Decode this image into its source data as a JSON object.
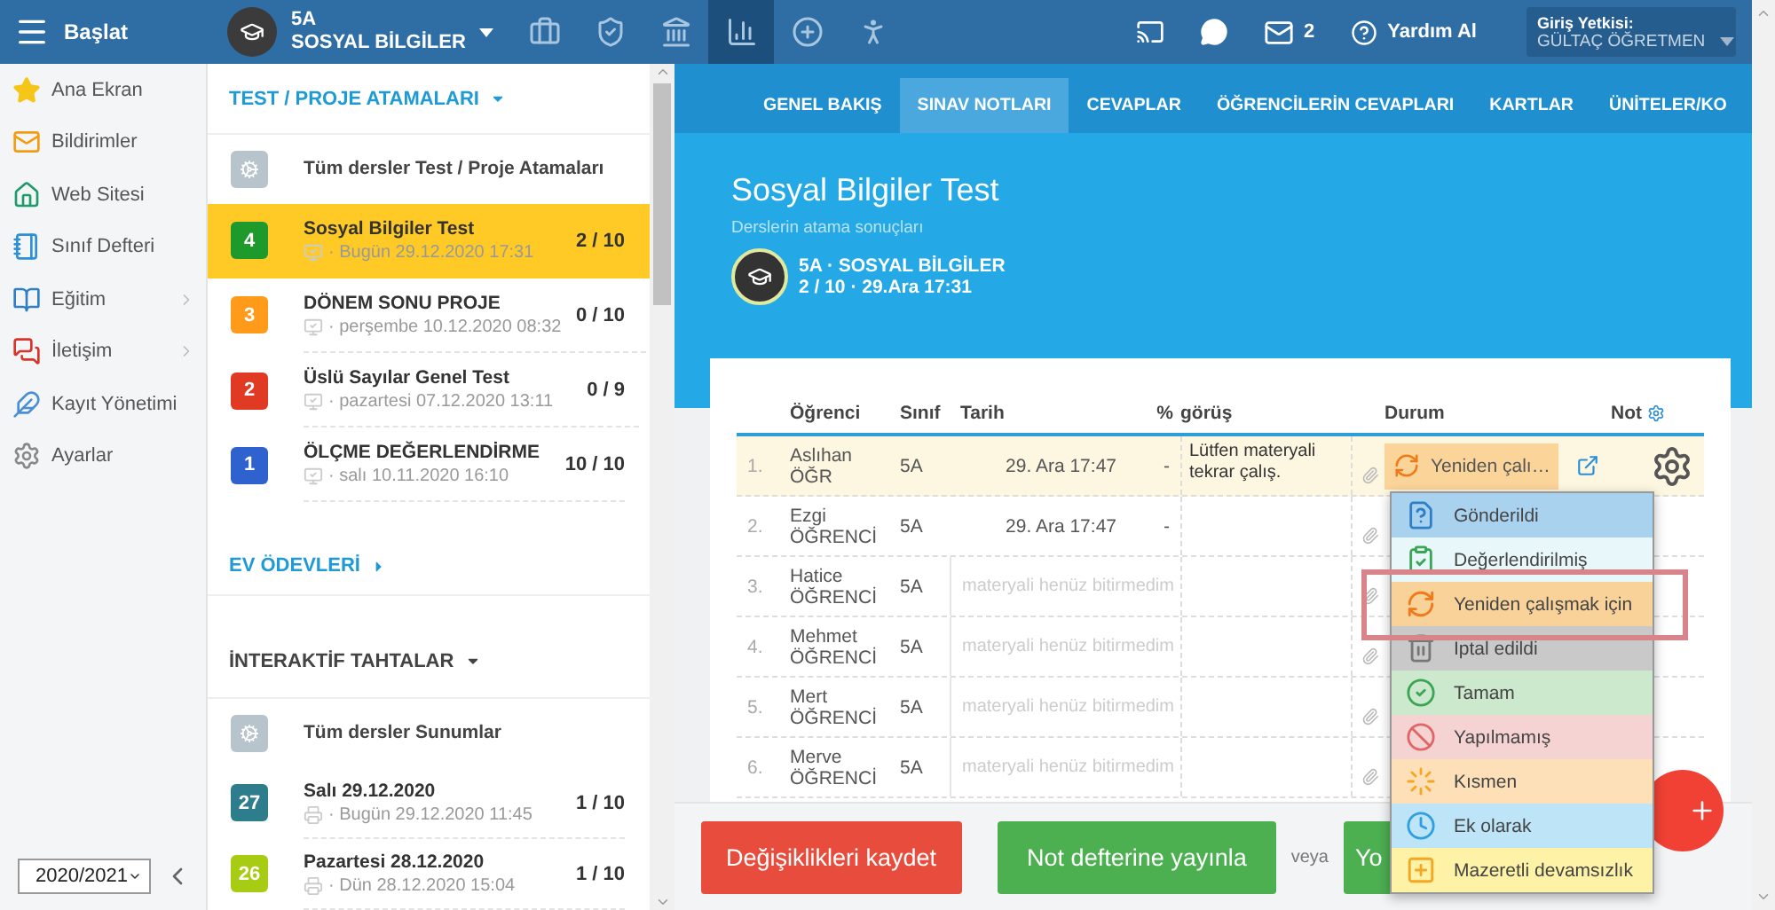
{
  "topbar": {
    "menu_label": "Başlat",
    "class_name": "5A",
    "class_subject": "SOSYAL BİLGİLER",
    "tools": [
      {
        "selected": false
      },
      {
        "selected": false
      },
      {
        "selected": false
      },
      {
        "selected": true
      },
      {
        "selected": false
      },
      {
        "selected": false
      }
    ],
    "mail_count": "2",
    "help": "Yardım Al",
    "login_label": "Giriş Yetkisi:",
    "login_user": "GÜLTAÇ ÖĞRETMEN"
  },
  "sidebar": {
    "items": [
      {
        "label": "Ana Ekran",
        "has_submenu": false
      },
      {
        "label": "Bildirimler",
        "has_submenu": false
      },
      {
        "label": "Web Sitesi",
        "has_submenu": false
      },
      {
        "label": "Sınıf Defteri",
        "has_submenu": false
      },
      {
        "label": "Eğitim",
        "has_submenu": true
      },
      {
        "label": "İletişim",
        "has_submenu": true
      },
      {
        "label": "Kayıt Yönetimi",
        "has_submenu": false
      },
      {
        "label": "Ayarlar",
        "has_submenu": false
      }
    ],
    "year": "2020/2021"
  },
  "sections": [
    {
      "title": "TEST / PROJE ATAMALARI",
      "kind": "tests",
      "expanded": true,
      "all_label": "Tüm dersler Test / Proje Atamaları",
      "items": [
        {
          "badge": "4",
          "color": "#1e9a2c",
          "title": "Sosyal Bilgiler Test",
          "date": "· Bugün 29.12.2020 17:31",
          "score": "2 / 10",
          "selected": true
        },
        {
          "badge": "3",
          "color": "#ff9a1a",
          "title": "DÖNEM SONU PROJE",
          "date": "· perşembe 10.12.2020 08:32",
          "score": "0 / 10",
          "selected": false
        },
        {
          "badge": "2",
          "color": "#e03a24",
          "title": "Üslü Sayılar Genel Test",
          "date": "· pazartesi 07.12.2020 13:11",
          "score": "0 / 9",
          "selected": false
        },
        {
          "badge": "1",
          "color": "#2f62cf",
          "title": "ÖLÇME DEĞERLENDİRME",
          "date": "· salı 10.11.2020 16:10",
          "score": "10 / 10",
          "selected": false
        }
      ]
    },
    {
      "title": "EV ÖDEVLERİ",
      "kind": "homework",
      "expanded": false
    },
    {
      "title": "İNTERAKTİF TAHTALAR",
      "kind": "boards",
      "expanded": true,
      "all_label": "Tüm dersler Sunumlar",
      "items": [
        {
          "badge": "27",
          "color": "#2e7d8c",
          "title": "Salı 29.12.2020",
          "date": "· Bugün 29.12.2020 11:45",
          "score": "1 / 10",
          "selected": false
        },
        {
          "badge": "26",
          "color": "#a8cc14",
          "title": "Pazartesi 28.12.2020",
          "date": "· Dün 28.12.2020 15:04",
          "score": "1 / 10",
          "selected": false
        }
      ]
    }
  ],
  "tabs": [
    {
      "label": "GENEL BAKIŞ",
      "selected": false
    },
    {
      "label": "SINAV NOTLARI",
      "selected": true
    },
    {
      "label": "CEVAPLAR",
      "selected": false
    },
    {
      "label": "ÖĞRENCİLERİN CEVAPLARI",
      "selected": false
    },
    {
      "label": "KARTLAR",
      "selected": false
    },
    {
      "label": "ÜNİTELER/KO",
      "selected": false
    }
  ],
  "header": {
    "title": "Sosyal Bilgiler Test",
    "subtitle": "Derslerin atama sonuçları",
    "class_line": "5A · SOSYAL BİLGİLER",
    "meta": "2 / 10 · 29.Ara 17:31"
  },
  "table": {
    "columns": [
      "Öğrenci",
      "Sınıf",
      "Tarih",
      "%",
      "görüş",
      "Durum",
      "Not"
    ],
    "rows": [
      {
        "kind": "submitted",
        "no": "1.",
        "first": "Aslıhan",
        "last": "ÖĞR",
        "class": "5A",
        "date": "29. Ara 17:47",
        "percent": "-",
        "note": "Lütfen materyali tekrar çalış.",
        "status": "Yeniden çalı…",
        "selected": true
      },
      {
        "kind": "submitted",
        "no": "2.",
        "first": "Ezgi",
        "last": "ÖĞRENCİ",
        "class": "5A",
        "date": "29. Ara 17:47",
        "percent": "-",
        "selected": false
      },
      {
        "kind": "pending",
        "no": "3.",
        "first": "Hatice",
        "last": "ÖĞRENCİ",
        "class": "5A",
        "pending": "materyali henüz bitirmedim",
        "selected": false
      },
      {
        "kind": "pending",
        "no": "4.",
        "first": "Mehmet",
        "last": "ÖĞRENCİ",
        "class": "5A",
        "pending": "materyali henüz bitirmedim",
        "selected": false
      },
      {
        "kind": "pending",
        "no": "5.",
        "first": "Mert",
        "last": "ÖĞRENCİ",
        "class": "5A",
        "pending": "materyali henüz bitirmedim",
        "selected": false
      },
      {
        "kind": "pending",
        "no": "6.",
        "first": "Merve",
        "last": "ÖĞRENCİ",
        "class": "5A",
        "pending": "materyali henüz bitirmedim",
        "selected": false
      }
    ]
  },
  "status_menu": {
    "options": [
      {
        "label": "Gönderildi",
        "color": "#a9d2ef",
        "highlighted": false
      },
      {
        "label": "Değerlendirilmiş",
        "color": "#e8f8fa",
        "highlighted": false
      },
      {
        "label": "Yeniden çalışmak için",
        "color": "#f9d29a",
        "highlighted": true
      },
      {
        "label": "İptal edildi",
        "color": "#c9c9c9",
        "highlighted": false
      },
      {
        "label": "Tamam",
        "color": "#cde9cd",
        "highlighted": false
      },
      {
        "label": "Yapılmamış",
        "color": "#f6d3d3",
        "highlighted": false
      },
      {
        "label": "Kısmen",
        "color": "#fde0b8",
        "highlighted": false
      },
      {
        "label": "Ek olarak",
        "color": "#bde4f7",
        "highlighted": false
      },
      {
        "label": "Mazeretli devamsızlık",
        "color": "#fdf2a5",
        "highlighted": false
      }
    ]
  },
  "footer": {
    "save": "Değişiklikleri kaydet",
    "publish": "Not defterine yayınla",
    "or": "veya",
    "third": "Yo"
  }
}
